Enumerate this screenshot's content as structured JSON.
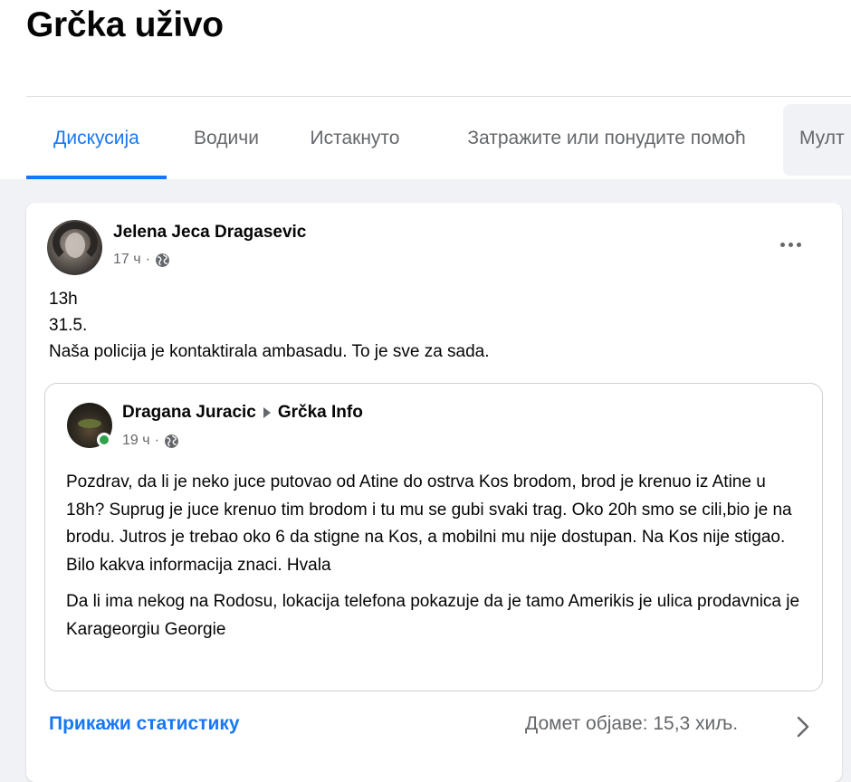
{
  "group": {
    "title": "Grčka uživo"
  },
  "tabs": [
    {
      "label": "Дискусија",
      "active": true
    },
    {
      "label": "Водичи",
      "active": false
    },
    {
      "label": "Истакнуто",
      "active": false
    },
    {
      "label": "Затражите или понудите помоћ",
      "active": false
    },
    {
      "label": "Мулт",
      "active": false
    }
  ],
  "post": {
    "author": "Jelena Jeca Dragasevic",
    "time": "17 ч",
    "separator": "·",
    "privacy_icon": "globe-icon",
    "more_icon": "more-dots-icon",
    "text_lines": [
      "13h",
      "31.5.",
      "Naša policija je kontaktirala ambasadu. To je sve za sada."
    ],
    "shared": {
      "author": "Dragana Juracic",
      "group": "Grčka Info",
      "time": "19 ч",
      "separator": "·",
      "privacy_icon": "globe-icon",
      "online": true,
      "paragraphs": [
        "Pozdrav, da li je neko juce putovao od Atine do ostrva Kos brodom, brod je krenuo iz Atine u 18h? Suprug je juce krenuo tim brodom i tu mu se gubi svaki trag. Oko 20h smo se cili,bio je na brodu. Jutros je trebao oko 6 da stigne na Kos, a mobilni mu nije dostupan. Na Kos nije stigao. Bilo kakva informacija znaci. Hvala",
        "Da li ima nekog na Rodosu, lokacija telefona pokazuje da je tamo Amerikis je ulica prodavnica je Karageorgiu Georgie"
      ]
    },
    "footer": {
      "stats_link": "Прикажи статистику",
      "reach": "Домет објаве: 15,3 хиљ.",
      "chevron_icon": "chevron-right-icon"
    }
  },
  "colors": {
    "accent": "#1877f2",
    "secondary_text": "#65676b",
    "page_background": "#f0f2f5",
    "online": "#31a24c"
  }
}
